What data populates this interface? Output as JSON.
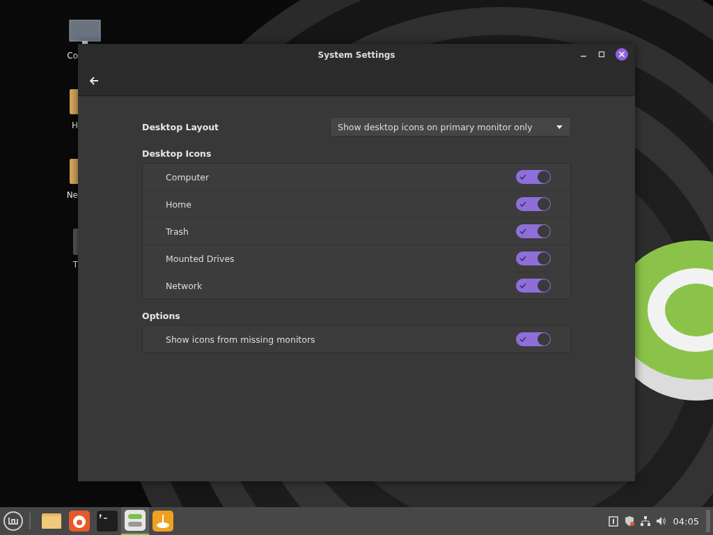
{
  "desktop_icons": [
    {
      "kind": "computer",
      "label": "Co"
    },
    {
      "kind": "folder",
      "label": "H"
    },
    {
      "kind": "folder",
      "label": "Ne"
    },
    {
      "kind": "trash",
      "label": "T"
    }
  ],
  "window": {
    "title": "System Settings"
  },
  "layout": {
    "label": "Desktop Layout",
    "value": "Show desktop icons on primary monitor only"
  },
  "sections": [
    {
      "title": "Desktop Icons",
      "items": [
        {
          "label": "Computer",
          "on": true
        },
        {
          "label": "Home",
          "on": true
        },
        {
          "label": "Trash",
          "on": true
        },
        {
          "label": "Mounted Drives",
          "on": true
        },
        {
          "label": "Network",
          "on": true
        }
      ]
    },
    {
      "title": "Options",
      "items": [
        {
          "label": "Show icons from missing monitors",
          "on": true
        }
      ]
    }
  ],
  "taskbar": {
    "apps": [
      {
        "kind": "folder",
        "selected": false
      },
      {
        "kind": "firefox",
        "selected": false
      },
      {
        "kind": "terminal",
        "selected": false
      },
      {
        "kind": "settings",
        "selected": true
      },
      {
        "kind": "software",
        "selected": false
      }
    ],
    "clock": "04:05"
  }
}
